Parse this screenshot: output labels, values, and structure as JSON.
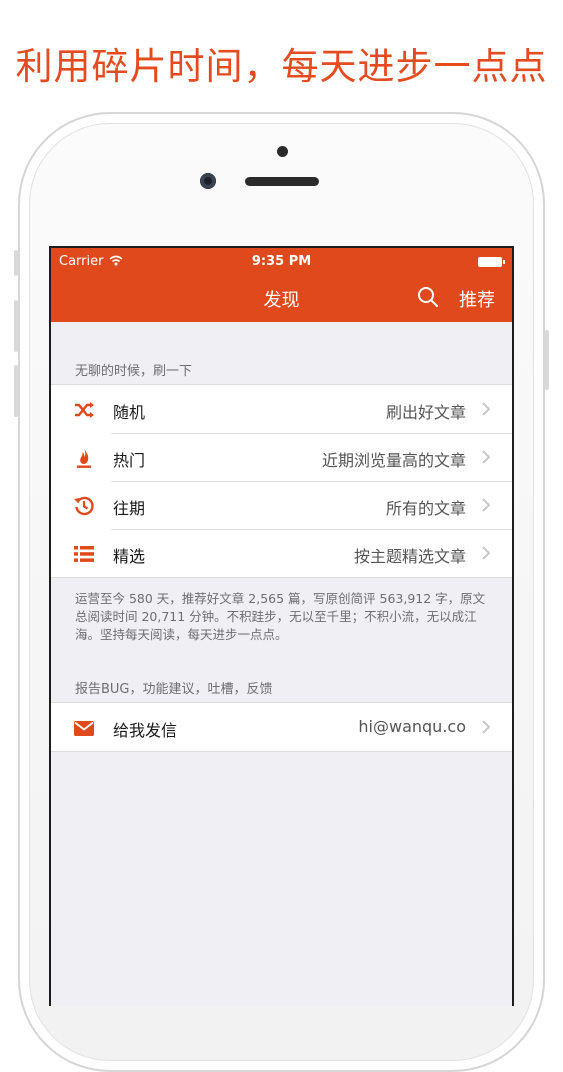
{
  "headline": "利用碎片时间，每天进步一点点",
  "status_bar": {
    "carrier": "Carrier",
    "time": "9:35 PM"
  },
  "navbar": {
    "title": "发现",
    "right_button": "推荐"
  },
  "colors": {
    "accent": "#e0491c",
    "headline": "#e44b1f",
    "background": "#efeff4"
  },
  "sections": [
    {
      "header": "无聊的时候，刷一下",
      "rows": [
        {
          "icon": "shuffle-icon",
          "label": "随机",
          "detail": "刷出好文章"
        },
        {
          "icon": "flame-icon",
          "label": "热门",
          "detail": "近期浏览量高的文章"
        },
        {
          "icon": "history-icon",
          "label": "往期",
          "detail": "所有的文章"
        },
        {
          "icon": "list-icon",
          "label": "精选",
          "detail": "按主题精选文章"
        }
      ],
      "footer": "运营至今 580 天，推荐好文章 2,565 篇，写原创简评 563,912 字，原文总阅读时间 20,711 分钟。不积跬步，无以至千里；不积小流，无以成江海。坚持每天阅读，每天进步一点点。"
    },
    {
      "header": "报告BUG，功能建议，吐槽，反馈",
      "rows": [
        {
          "icon": "mail-icon",
          "label": "给我发信",
          "detail": "hi@wanqu.co"
        }
      ]
    }
  ]
}
